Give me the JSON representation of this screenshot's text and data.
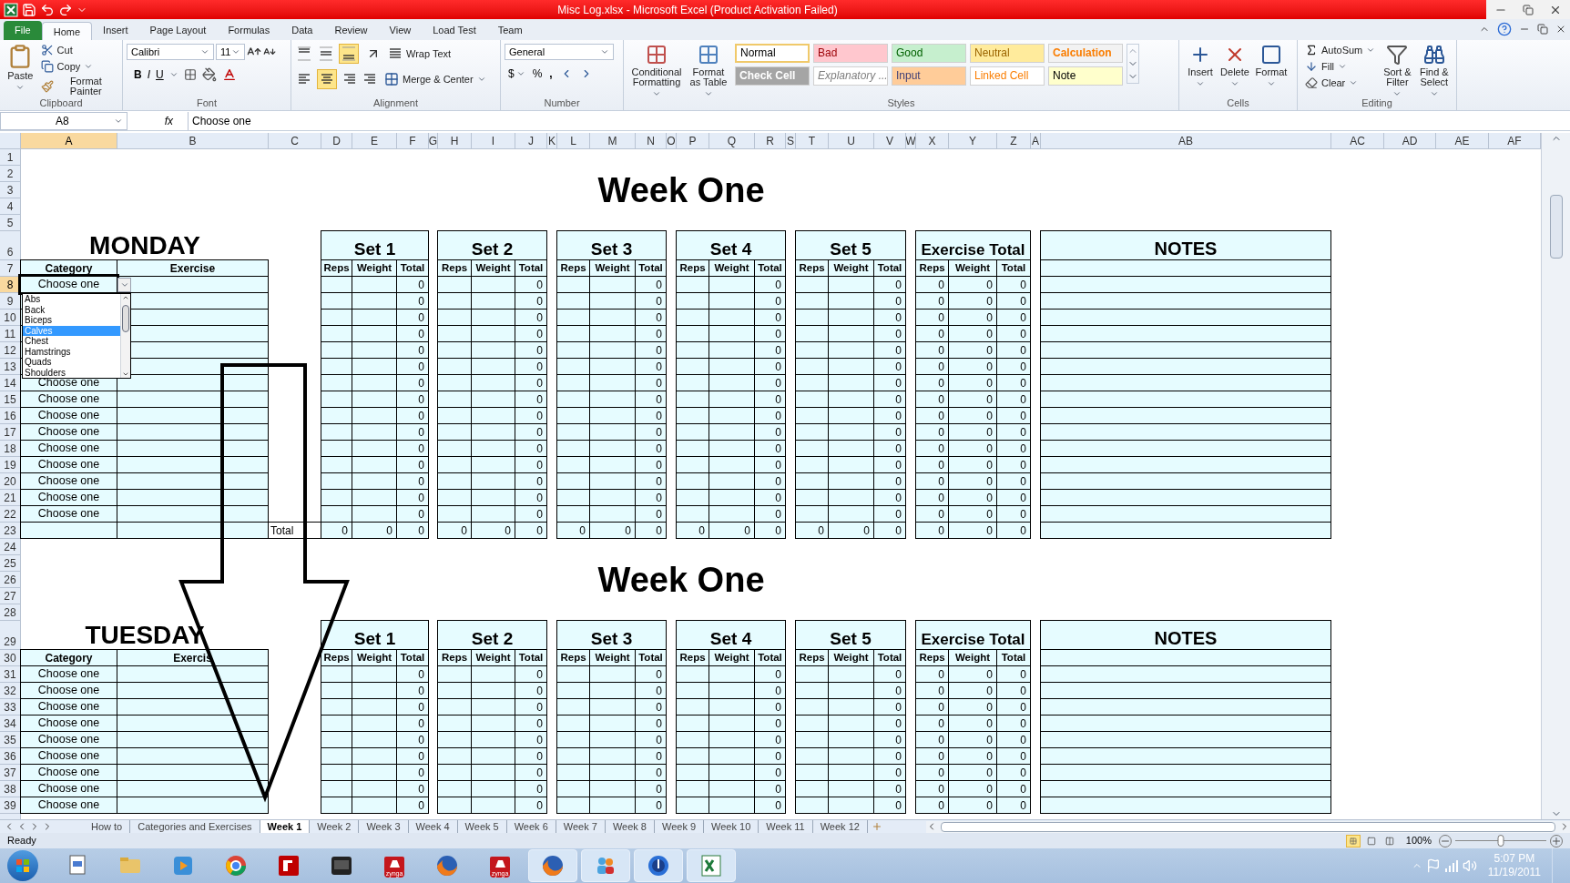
{
  "window": {
    "title": "Misc Log.xlsx - Microsoft Excel (Product Activation Failed)"
  },
  "ribbon_tabs": [
    {
      "label": "File",
      "kind": "file",
      "selected": false
    },
    {
      "label": "Home",
      "kind": "tab",
      "selected": true
    },
    {
      "label": "Insert",
      "kind": "tab",
      "selected": false
    },
    {
      "label": "Page Layout",
      "kind": "tab",
      "selected": false
    },
    {
      "label": "Formulas",
      "kind": "tab",
      "selected": false
    },
    {
      "label": "Data",
      "kind": "tab",
      "selected": false
    },
    {
      "label": "Review",
      "kind": "tab",
      "selected": false
    },
    {
      "label": "View",
      "kind": "tab",
      "selected": false
    },
    {
      "label": "Load Test",
      "kind": "tab",
      "selected": false
    },
    {
      "label": "Team",
      "kind": "tab",
      "selected": false
    }
  ],
  "clipboard": {
    "label": "Clipboard",
    "paste": "Paste",
    "cut": "Cut",
    "copy": "Copy",
    "format_painter": "Format Painter"
  },
  "font": {
    "label": "Font",
    "family": "Calibri",
    "size": "11",
    "bold": "B",
    "italic": "I",
    "underline": "U"
  },
  "alignment": {
    "label": "Alignment",
    "wrap_text": "Wrap Text",
    "merge": "Merge & Center",
    "vertical": [
      {
        "kind": "top",
        "selected": false
      },
      {
        "kind": "middle",
        "selected": false
      },
      {
        "kind": "bottom",
        "selected": true
      }
    ],
    "horizontal": [
      {
        "kind": "left",
        "selected": false
      },
      {
        "kind": "center",
        "selected": true
      },
      {
        "kind": "right",
        "selected": false
      }
    ]
  },
  "number": {
    "label": "Number",
    "format": "General",
    "currency": "$",
    "percent": "%",
    "comma": ","
  },
  "styles": {
    "label": "Styles",
    "conditional": "Conditional Formatting",
    "format_table": "Format as Table",
    "items": [
      {
        "label": "Normal",
        "kind": "normal",
        "selected": true
      },
      {
        "label": "Bad",
        "kind": "bad",
        "selected": false
      },
      {
        "label": "Good",
        "kind": "good",
        "selected": false
      },
      {
        "label": "Neutral",
        "kind": "neutral",
        "selected": false
      },
      {
        "label": "Calculation",
        "kind": "calculation",
        "selected": false
      },
      {
        "label": "Check Cell",
        "kind": "check",
        "selected": false
      },
      {
        "label": "Explanatory ...",
        "kind": "explanatory",
        "selected": false
      },
      {
        "label": "Input",
        "kind": "input",
        "selected": false
      },
      {
        "label": "Linked Cell",
        "kind": "linked",
        "selected": false
      },
      {
        "label": "Note",
        "kind": "note",
        "selected": false
      }
    ]
  },
  "cells": {
    "label": "Cells",
    "insert": "Insert",
    "delete": "Delete",
    "format": "Format"
  },
  "editing": {
    "label": "Editing",
    "autosum": "AutoSum",
    "fill": "Fill",
    "clear": "Clear",
    "sort": "Sort & Filter",
    "find": "Find & Select"
  },
  "formula_bar": {
    "name_box": "A8",
    "function_label": "fx",
    "formula": "Choose one"
  },
  "sheet": {
    "columns": [
      {
        "label": "A",
        "selected": true
      },
      {
        "label": "B",
        "selected": false
      },
      {
        "label": "C",
        "selected": false
      },
      {
        "label": "D",
        "selected": false
      },
      {
        "label": "E",
        "selected": false
      },
      {
        "label": "F",
        "selected": false
      },
      {
        "label": "G",
        "selected": false
      },
      {
        "label": "H",
        "selected": false
      },
      {
        "label": "I",
        "selected": false
      },
      {
        "label": "J",
        "selected": false
      },
      {
        "label": "K",
        "selected": false
      },
      {
        "label": "L",
        "selected": false
      },
      {
        "label": "M",
        "selected": false
      },
      {
        "label": "N",
        "selected": false
      },
      {
        "label": "O",
        "selected": false
      },
      {
        "label": "P",
        "selected": false
      },
      {
        "label": "Q",
        "selected": false
      },
      {
        "label": "R",
        "selected": false
      },
      {
        "label": "S",
        "selected": false
      },
      {
        "label": "T",
        "selected": false
      },
      {
        "label": "U",
        "selected": false
      },
      {
        "label": "V",
        "selected": false
      },
      {
        "label": "W",
        "selected": false
      },
      {
        "label": "X",
        "selected": false
      },
      {
        "label": "Y",
        "selected": false
      },
      {
        "label": "Z",
        "selected": false
      },
      {
        "label": "A",
        "selected": false
      },
      {
        "label": "AB",
        "selected": false
      },
      {
        "label": "AC",
        "selected": false
      },
      {
        "label": "AD",
        "selected": false
      },
      {
        "label": "AE",
        "selected": false
      },
      {
        "label": "AF",
        "selected": false
      }
    ],
    "rows": [
      {
        "label": "1",
        "selected": false
      },
      {
        "label": "2",
        "selected": false
      },
      {
        "label": "3",
        "selected": false
      },
      {
        "label": "4",
        "selected": false
      },
      {
        "label": "5",
        "selected": false
      },
      {
        "label": "6",
        "selected": false
      },
      {
        "label": "7",
        "selected": false
      },
      {
        "label": "8",
        "selected": true
      },
      {
        "label": "9",
        "selected": false
      },
      {
        "label": "10",
        "selected": false
      },
      {
        "label": "11",
        "selected": false
      },
      {
        "label": "12",
        "selected": false
      },
      {
        "label": "13",
        "selected": false
      },
      {
        "label": "14",
        "selected": false
      },
      {
        "label": "15",
        "selected": false
      },
      {
        "label": "16",
        "selected": false
      },
      {
        "label": "17",
        "selected": false
      },
      {
        "label": "18",
        "selected": false
      },
      {
        "label": "19",
        "selected": false
      },
      {
        "label": "20",
        "selected": false
      },
      {
        "label": "21",
        "selected": false
      },
      {
        "label": "22",
        "selected": false
      },
      {
        "label": "23",
        "selected": false
      },
      {
        "label": "24",
        "selected": false
      },
      {
        "label": "25",
        "selected": false
      },
      {
        "label": "26",
        "selected": false
      },
      {
        "label": "27",
        "selected": false
      },
      {
        "label": "28",
        "selected": false
      },
      {
        "label": "29",
        "selected": false
      },
      {
        "label": "30",
        "selected": false
      },
      {
        "label": "31",
        "selected": false
      },
      {
        "label": "32",
        "selected": false
      },
      {
        "label": "33",
        "selected": false
      },
      {
        "label": "34",
        "selected": false
      },
      {
        "label": "35",
        "selected": false
      },
      {
        "label": "36",
        "selected": false
      },
      {
        "label": "37",
        "selected": false
      },
      {
        "label": "38",
        "selected": false
      },
      {
        "label": "39",
        "selected": false
      }
    ],
    "blocks": [
      {
        "week_title": "Week One",
        "day": "MONDAY",
        "category_header": "Category",
        "exercise_header": "Exercise",
        "sets": [
          {
            "title": "Set 1",
            "columns": [
              "Reps",
              "Weight",
              "Total"
            ]
          },
          {
            "title": "Set 2",
            "columns": [
              "Reps",
              "Weight",
              "Total"
            ]
          },
          {
            "title": "Set 3",
            "columns": [
              "Reps",
              "Weight",
              "Total"
            ]
          },
          {
            "title": "Set 4",
            "columns": [
              "Reps",
              "Weight",
              "Total"
            ]
          },
          {
            "title": "Set 5",
            "columns": [
              "Reps",
              "Weight",
              "Total"
            ]
          }
        ],
        "exercise_total": {
          "title": "Exercise Total",
          "columns": [
            "Reps",
            "Weight",
            "Total"
          ]
        },
        "notes_title": "NOTES",
        "rows": [
          {
            "category": "Choose one",
            "set_totals": [
              "0",
              "0",
              "0",
              "0",
              "0"
            ],
            "exercise_totals": [
              "0",
              "0",
              "0"
            ]
          },
          {
            "set_totals": [
              "0",
              "0",
              "0",
              "0",
              "0"
            ],
            "exercise_totals": [
              "0",
              "0",
              "0"
            ]
          },
          {
            "set_totals": [
              "0",
              "0",
              "0",
              "0",
              "0"
            ],
            "exercise_totals": [
              "0",
              "0",
              "0"
            ]
          },
          {
            "set_totals": [
              "0",
              "0",
              "0",
              "0",
              "0"
            ],
            "exercise_totals": [
              "0",
              "0",
              "0"
            ]
          },
          {
            "set_totals": [
              "0",
              "0",
              "0",
              "0",
              "0"
            ],
            "exercise_totals": [
              "0",
              "0",
              "0"
            ]
          },
          {
            "set_totals": [
              "0",
              "0",
              "0",
              "0",
              "0"
            ],
            "exercise_totals": [
              "0",
              "0",
              "0"
            ]
          },
          {
            "category": "Choose one",
            "set_totals": [
              "0",
              "0",
              "0",
              "0",
              "0"
            ],
            "exercise_totals": [
              "0",
              "0",
              "0"
            ]
          },
          {
            "category": "Choose one",
            "set_totals": [
              "0",
              "0",
              "0",
              "0",
              "0"
            ],
            "exercise_totals": [
              "0",
              "0",
              "0"
            ]
          },
          {
            "category": "Choose one",
            "set_totals": [
              "0",
              "0",
              "0",
              "0",
              "0"
            ],
            "exercise_totals": [
              "0",
              "0",
              "0"
            ]
          },
          {
            "category": "Choose one",
            "set_totals": [
              "0",
              "0",
              "0",
              "0",
              "0"
            ],
            "exercise_totals": [
              "0",
              "0",
              "0"
            ]
          },
          {
            "category": "Choose one",
            "set_totals": [
              "0",
              "0",
              "0",
              "0",
              "0"
            ],
            "exercise_totals": [
              "0",
              "0",
              "0"
            ]
          },
          {
            "category": "Choose one",
            "set_totals": [
              "0",
              "0",
              "0",
              "0",
              "0"
            ],
            "exercise_totals": [
              "0",
              "0",
              "0"
            ]
          },
          {
            "category": "Choose one",
            "set_totals": [
              "0",
              "0",
              "0",
              "0",
              "0"
            ],
            "exercise_totals": [
              "0",
              "0",
              "0"
            ]
          },
          {
            "category": "Choose one",
            "set_totals": [
              "0",
              "0",
              "0",
              "0",
              "0"
            ],
            "exercise_totals": [
              "0",
              "0",
              "0"
            ]
          },
          {
            "category": "Choose one",
            "set_totals": [
              "0",
              "0",
              "0",
              "0",
              "0"
            ],
            "exercise_totals": [
              "0",
              "0",
              "0"
            ]
          }
        ],
        "total_row": {
          "label": "Total",
          "values": [
            "0",
            "0",
            "0",
            "0",
            "0",
            "0",
            "0",
            "0",
            "0",
            "0",
            "0",
            "0",
            "0",
            "0",
            "0",
            "0",
            "0",
            "0"
          ]
        }
      },
      {
        "week_title": "Week One",
        "day": "TUESDAY",
        "category_header": "Category",
        "exercise_header": "Exercis",
        "sets": [
          {
            "title": "Set 1",
            "columns": [
              "Reps",
              "Weight",
              "Total"
            ]
          },
          {
            "title": "Set 2",
            "columns": [
              "Reps",
              "Weight",
              "Total"
            ]
          },
          {
            "title": "Set 3",
            "columns": [
              "Reps",
              "Weight",
              "Total"
            ]
          },
          {
            "title": "Set 4",
            "columns": [
              "Reps",
              "Weight",
              "Total"
            ]
          },
          {
            "title": "Set 5",
            "columns": [
              "Reps",
              "Weight",
              "Total"
            ]
          }
        ],
        "exercise_total": {
          "title": "Exercise Total",
          "columns": [
            "Reps",
            "Weight",
            "Total"
          ]
        },
        "notes_title": "NOTES",
        "rows": [
          {
            "category": "Choose one",
            "set_totals": [
              "0",
              "0",
              "0",
              "0",
              "0"
            ],
            "exercise_totals": [
              "0",
              "0",
              "0"
            ]
          },
          {
            "category": "Choose one",
            "set_totals": [
              "0",
              "0",
              "0",
              "0",
              "0"
            ],
            "exercise_totals": [
              "0",
              "0",
              "0"
            ]
          },
          {
            "category": "Choose one",
            "set_totals": [
              "0",
              "0",
              "0",
              "0",
              "0"
            ],
            "exercise_totals": [
              "0",
              "0",
              "0"
            ]
          },
          {
            "category": "Choose one",
            "set_totals": [
              "0",
              "0",
              "0",
              "0",
              "0"
            ],
            "exercise_totals": [
              "0",
              "0",
              "0"
            ]
          },
          {
            "category": "Choose one",
            "set_totals": [
              "0",
              "0",
              "0",
              "0",
              "0"
            ],
            "exercise_totals": [
              "0",
              "0",
              "0"
            ]
          },
          {
            "category": "Choose one",
            "set_totals": [
              "0",
              "0",
              "0",
              "0",
              "0"
            ],
            "exercise_totals": [
              "0",
              "0",
              "0"
            ]
          },
          {
            "category": "Choose one",
            "set_totals": [
              "0",
              "0",
              "0",
              "0",
              "0"
            ],
            "exercise_totals": [
              "0",
              "0",
              "0"
            ]
          },
          {
            "category": "Choose one",
            "set_totals": [
              "0",
              "0",
              "0",
              "0",
              "0"
            ],
            "exercise_totals": [
              "0",
              "0",
              "0"
            ]
          },
          {
            "category": "Choose one",
            "set_totals": [
              "0",
              "0",
              "0",
              "0",
              "0"
            ],
            "exercise_totals": [
              "0",
              "0",
              "0"
            ]
          }
        ]
      }
    ],
    "dropdown": {
      "items": [
        {
          "label": "Abs",
          "selected": false
        },
        {
          "label": "Back",
          "selected": false
        },
        {
          "label": "Biceps",
          "selected": false
        },
        {
          "label": "Calves",
          "selected": true
        },
        {
          "label": "Chest",
          "selected": false
        },
        {
          "label": "Hamstrings",
          "selected": false
        },
        {
          "label": "Quads",
          "selected": false
        },
        {
          "label": "Shoulders",
          "selected": false
        }
      ]
    }
  },
  "sheet_tabs": [
    {
      "label": "How to",
      "selected": false
    },
    {
      "label": "Categories and Exercises",
      "selected": false
    },
    {
      "label": "Week 1",
      "selected": true
    },
    {
      "label": "Week 2",
      "selected": false
    },
    {
      "label": "Week 3",
      "selected": false
    },
    {
      "label": "Week 4",
      "selected": false
    },
    {
      "label": "Week 5",
      "selected": false
    },
    {
      "label": "Week 6",
      "selected": false
    },
    {
      "label": "Week 7",
      "selected": false
    },
    {
      "label": "Week 8",
      "selected": false
    },
    {
      "label": "Week 9",
      "selected": false
    },
    {
      "label": "Week 10",
      "selected": false
    },
    {
      "label": "Week 11",
      "selected": false
    },
    {
      "label": "Week 12",
      "selected": false
    }
  ],
  "status_bar": {
    "status": "Ready",
    "views": [
      {
        "kind": "normal",
        "selected": true
      },
      {
        "kind": "page_layout",
        "selected": false
      },
      {
        "kind": "page_break",
        "selected": false
      }
    ],
    "zoom": {
      "label": "100%",
      "level": 0.5
    }
  },
  "taskbar": {
    "apps": [
      {
        "kind": "doc",
        "active": false
      },
      {
        "kind": "folder",
        "active": false
      },
      {
        "kind": "media",
        "active": false
      },
      {
        "kind": "browser",
        "active": false
      },
      {
        "kind": "ftp",
        "active": false
      },
      {
        "kind": "terminal",
        "active": false
      },
      {
        "kind": "zynga",
        "label": "zynga",
        "active": false
      },
      {
        "kind": "firefox",
        "active": false
      },
      {
        "kind": "zynga",
        "label": "zynga",
        "active": false
      },
      {
        "kind": "firefox",
        "active": true
      },
      {
        "kind": "messenger",
        "active": true
      },
      {
        "kind": "music",
        "active": true
      },
      {
        "kind": "excel",
        "active": true
      }
    ],
    "time": "5:07 PM",
    "date": "11/19/2011"
  }
}
